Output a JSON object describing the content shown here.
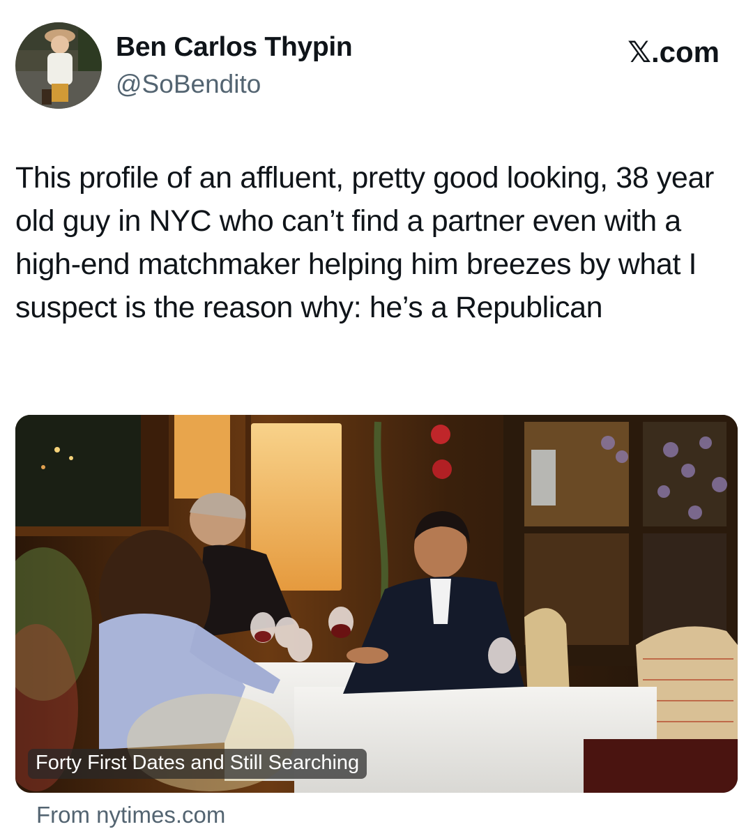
{
  "author": {
    "display_name": "Ben Carlos Thypin",
    "handle": "@SoBendito"
  },
  "site_label": "𝕏.com",
  "tweet": {
    "text": "This profile of an affluent, pretty good looking, 38 year old guy in NYC who can’t find a partner even with a high-end matchmaker helping him breezes by what I suspect is the reason why: he’s a Republican"
  },
  "card": {
    "title": "Forty First Dates and Still Searching",
    "source": "From nytimes.com"
  },
  "colors": {
    "text_primary": "#0f1419",
    "text_secondary": "#536471"
  },
  "icons": {
    "avatar": "avatar-photo",
    "card_image": "restaurant-photo"
  }
}
